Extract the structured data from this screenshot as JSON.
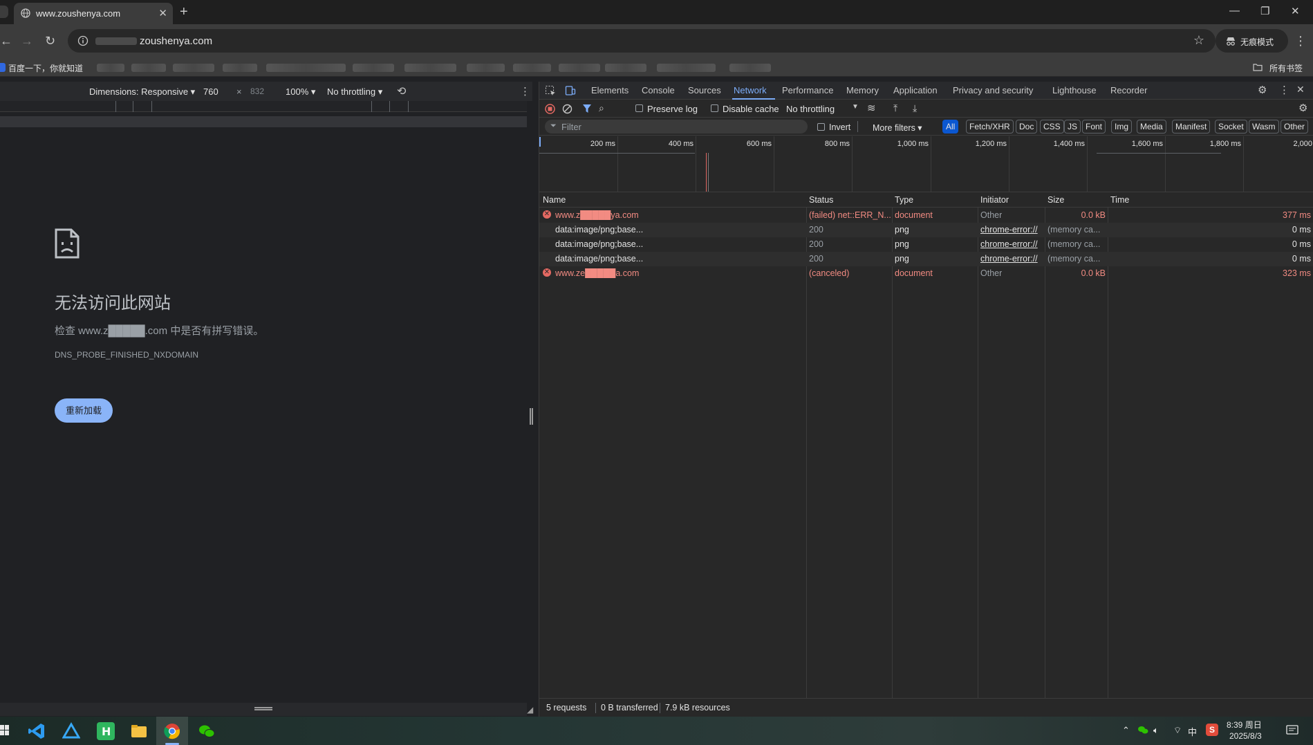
{
  "browser": {
    "tab_title": "www.zoushenya.com",
    "new_tab": "+",
    "url": "zoushenya.com",
    "incognito_label": "无痕模式",
    "window_controls": {
      "minimize": "—",
      "restore": "❐",
      "close": "✕"
    }
  },
  "bookmarks": {
    "first": "百度一下，你就知道",
    "all_bookmarks": "所有书签"
  },
  "device_toolbar": {
    "dimensions_label": "Dimensions: Responsive ▾",
    "width": "760",
    "times": "×",
    "height": "832",
    "zoom": "100% ▾",
    "throttling": "No throttling ▾"
  },
  "error_page": {
    "title": "无法访问此网站",
    "description": "检查 www.z█████.com 中是否有拼写错误。",
    "code": "DNS_PROBE_FINISHED_NXDOMAIN",
    "reload_button": "重新加载"
  },
  "devtools": {
    "tabs": [
      "Elements",
      "Console",
      "Sources",
      "Network",
      "Performance",
      "Memory",
      "Application",
      "Privacy and security",
      "Lighthouse",
      "Recorder"
    ],
    "active_tab": "Network",
    "toolbar": {
      "preserve_log": "Preserve log",
      "disable_cache": "Disable cache",
      "throttling": "No throttling"
    },
    "filter": {
      "placeholder": "Filter",
      "invert": "Invert",
      "more_filters": "More filters ▾",
      "chips": [
        "All",
        "Fetch/XHR",
        "Doc",
        "CSS",
        "JS",
        "Font",
        "Img",
        "Media",
        "Manifest",
        "Socket",
        "Wasm",
        "Other"
      ]
    },
    "timeline_ticks": [
      "200 ms",
      "400 ms",
      "600 ms",
      "800 ms",
      "1,000 ms",
      "1,200 ms",
      "1,400 ms",
      "1,600 ms",
      "1,800 ms",
      "2,000"
    ],
    "columns": [
      "Name",
      "Status",
      "Type",
      "Initiator",
      "Size",
      "Time"
    ],
    "rows": [
      {
        "name": "www.z█████ya.com",
        "status": "(failed) net::ERR_N...",
        "type": "document",
        "initiator": "Other",
        "size": "0.0 kB",
        "time": "377 ms",
        "error": true
      },
      {
        "name": "data:image/png;base...",
        "status": "200",
        "type": "png",
        "initiator": "chrome-error://",
        "size": "(memory ca...",
        "time": "0 ms",
        "error": false
      },
      {
        "name": "data:image/png;base...",
        "status": "200",
        "type": "png",
        "initiator": "chrome-error://",
        "size": "(memory ca...",
        "time": "0 ms",
        "error": false
      },
      {
        "name": "data:image/png;base...",
        "status": "200",
        "type": "png",
        "initiator": "chrome-error://",
        "size": "(memory ca...",
        "time": "0 ms",
        "error": false
      },
      {
        "name": "www.ze█████a.com",
        "status": "(canceled)",
        "type": "document",
        "initiator": "Other",
        "size": "0.0 kB",
        "time": "323 ms",
        "error": true
      }
    ],
    "status": {
      "requests": "5 requests",
      "transferred": "0 B transferred",
      "resources": "7.9 kB resources"
    }
  },
  "taskbar": {
    "ime": "中",
    "time": "8:39 周日",
    "date": "2025/8/3"
  },
  "colors": {
    "accent": "#7cacf8",
    "error": "#f28b82",
    "reload_button": "#8ab4f8"
  }
}
